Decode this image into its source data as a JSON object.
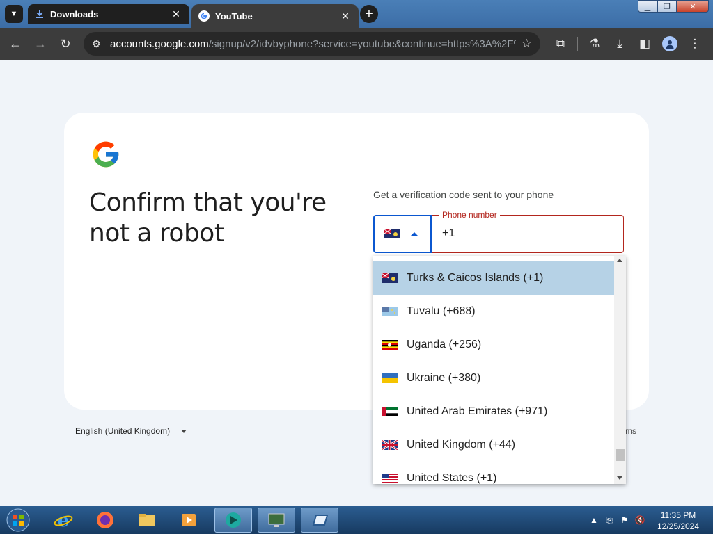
{
  "browser": {
    "tabs": [
      {
        "title": "Downloads",
        "icon": "download-icon"
      },
      {
        "title": "YouTube",
        "icon": "google-g-icon",
        "active": true
      }
    ],
    "url_host": "accounts.google.com",
    "url_path": "/signup/v2/idvbyphone?service=youtube&continue=https%3A%2F%2..."
  },
  "page": {
    "heading": "Confirm that you're not a robot",
    "subtext": "Get a verification code sent to your phone",
    "phone_label": "Phone number",
    "phone_value": "+1",
    "language": "English (United Kingdom)",
    "footer_right": "ms"
  },
  "dropdown": {
    "items": [
      {
        "label": "Turks & Caicos Islands (+1)",
        "flag": "turks-caicos",
        "selected": true
      },
      {
        "label": "Tuvalu (+688)",
        "flag": "tuvalu"
      },
      {
        "label": "Uganda (+256)",
        "flag": "uganda"
      },
      {
        "label": "Ukraine (+380)",
        "flag": "ukraine"
      },
      {
        "label": "United Arab Emirates (+971)",
        "flag": "uae"
      },
      {
        "label": "United Kingdom (+44)",
        "flag": "uk"
      },
      {
        "label": "United States (+1)",
        "flag": "us"
      }
    ]
  },
  "taskbar": {
    "time": "11:35 PM",
    "date": "12/25/2024",
    "apps": [
      "internet-explorer",
      "firefox",
      "file-explorer",
      "media-player",
      "app-teal",
      "app-monitor",
      "app-blue-window"
    ]
  },
  "colors": {
    "accent": "#0b57d0",
    "error": "#b3261e",
    "selected_item": "#b6d2e6",
    "page_background": "#f0f4f9"
  }
}
